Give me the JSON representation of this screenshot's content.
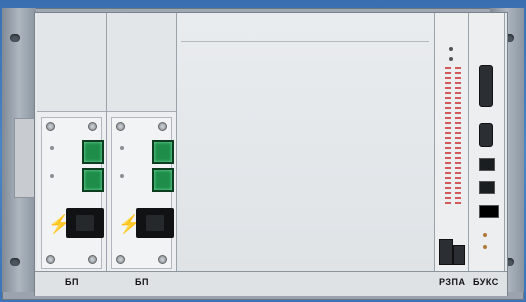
{
  "modules": {
    "psu1": {
      "label": "БП"
    },
    "psu2": {
      "label": "БП"
    },
    "rzpa": {
      "label": "РЗПА"
    },
    "buks": {
      "label": "БУКС"
    }
  },
  "colors": {
    "background": "#4a85c6",
    "chassis": "#e6e9ec",
    "switch_green": "#1e8d4a",
    "hazard_red": "#d51f1f"
  }
}
